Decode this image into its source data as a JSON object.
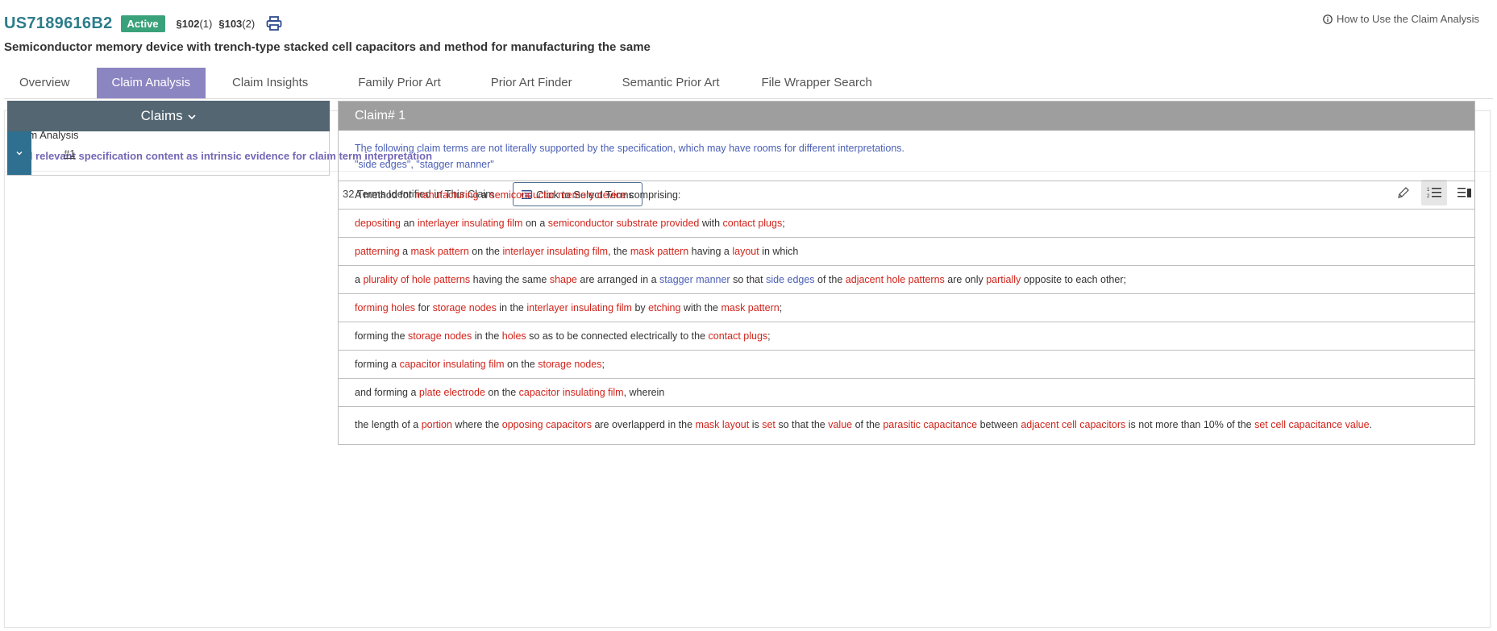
{
  "header": {
    "patent_number": "US7189616B2",
    "status_badge": "Active",
    "sections": [
      {
        "label": "§102",
        "count": "(1)"
      },
      {
        "label": "§103",
        "count": "(2)"
      }
    ],
    "print_icon": "print-icon",
    "howto_label": "How to Use the Claim Analysis",
    "howto_icon": "info-icon",
    "title": "Semiconductor memory device with trench-type stacked cell capacitors and method for manufacturing the same"
  },
  "tabs": [
    {
      "label": "Overview",
      "active": false
    },
    {
      "label": "Claim Analysis",
      "active": true
    },
    {
      "label": "Claim Insights",
      "active": false
    },
    {
      "label": "Family Prior Art",
      "active": false
    },
    {
      "label": "Prior Art Finder",
      "active": false
    },
    {
      "label": "Semantic Prior Art",
      "active": false
    },
    {
      "label": "File Wrapper Search",
      "active": false
    }
  ],
  "panel": {
    "title": "Claim Analysis",
    "subtitle": "Find relevant specification content as intrinsic evidence for claim term interpretation",
    "terms_count": "32 Terms Identified in This Claim",
    "select_button": "Click to Select Terms",
    "view_icons": [
      "pencil-icon",
      "numbered-list-icon",
      "list-detail-icon"
    ]
  },
  "sidebar": {
    "header": "Claims",
    "header_icon": "chevron-down-icon",
    "items": [
      {
        "label": "#1",
        "toggle_icon": "chevron-down-icon"
      }
    ]
  },
  "claim": {
    "header": "Claim# 1",
    "notice_line1": "The following claim terms are not literally supported by the specification, which may have rooms for different interpretations.",
    "notice_line2": "\"side edges\", \"stagger manner\"",
    "colors": {
      "term": "#d0241b",
      "unsupported_term": "#4a5fb5",
      "accent": "#8b85c1",
      "patent_number": "#2d7d8a",
      "active_badge": "#3aa27a"
    },
    "lines": [
      [
        {
          "t": "A method for "
        },
        {
          "t": "manufacturing",
          "k": "term"
        },
        {
          "t": " a "
        },
        {
          "t": "semiconductor memory device",
          "k": "term"
        },
        {
          "t": " comprising:"
        }
      ],
      [
        {
          "t": "depositing",
          "k": "term"
        },
        {
          "t": " an "
        },
        {
          "t": "interlayer insulating film",
          "k": "term"
        },
        {
          "t": " on a "
        },
        {
          "t": "semiconductor substrate provided",
          "k": "term"
        },
        {
          "t": " with "
        },
        {
          "t": "contact plugs",
          "k": "term"
        },
        {
          "t": ";"
        }
      ],
      [
        {
          "t": "patterning",
          "k": "term"
        },
        {
          "t": " a "
        },
        {
          "t": "mask pattern",
          "k": "term"
        },
        {
          "t": " on the "
        },
        {
          "t": "interlayer insulating film",
          "k": "term"
        },
        {
          "t": ", the "
        },
        {
          "t": "mask pattern",
          "k": "term"
        },
        {
          "t": " having a "
        },
        {
          "t": "layout",
          "k": "term"
        },
        {
          "t": " in which"
        }
      ],
      [
        {
          "t": "a "
        },
        {
          "t": "plurality of hole patterns",
          "k": "term"
        },
        {
          "t": " having the same "
        },
        {
          "t": "shape",
          "k": "term"
        },
        {
          "t": " are arranged in a "
        },
        {
          "t": "stagger manner",
          "k": "unsupported"
        },
        {
          "t": " so that "
        },
        {
          "t": "side edges",
          "k": "unsupported"
        },
        {
          "t": " of the "
        },
        {
          "t": "adjacent hole patterns",
          "k": "term"
        },
        {
          "t": " are only "
        },
        {
          "t": "partially",
          "k": "term"
        },
        {
          "t": " opposite to each other;"
        }
      ],
      [
        {
          "t": "forming holes",
          "k": "term"
        },
        {
          "t": " for "
        },
        {
          "t": "storage nodes",
          "k": "term"
        },
        {
          "t": " in the "
        },
        {
          "t": "interlayer insulating film",
          "k": "term"
        },
        {
          "t": " by "
        },
        {
          "t": "etching",
          "k": "term"
        },
        {
          "t": " with the "
        },
        {
          "t": "mask pattern",
          "k": "term"
        },
        {
          "t": ";"
        }
      ],
      [
        {
          "t": "forming the "
        },
        {
          "t": "storage nodes",
          "k": "term"
        },
        {
          "t": " in the "
        },
        {
          "t": "holes",
          "k": "term"
        },
        {
          "t": " so as to be connected electrically to the "
        },
        {
          "t": "contact plugs",
          "k": "term"
        },
        {
          "t": ";"
        }
      ],
      [
        {
          "t": "forming a "
        },
        {
          "t": "capacitor insulating film",
          "k": "term"
        },
        {
          "t": " on the "
        },
        {
          "t": "storage nodes",
          "k": "term"
        },
        {
          "t": ";"
        }
      ],
      [
        {
          "t": "and forming a "
        },
        {
          "t": "plate electrode",
          "k": "term"
        },
        {
          "t": " on the "
        },
        {
          "t": "capacitor insulating film",
          "k": "term"
        },
        {
          "t": ", wherein"
        }
      ],
      [
        {
          "t": "the length of a "
        },
        {
          "t": "portion",
          "k": "term"
        },
        {
          "t": " where the "
        },
        {
          "t": "opposing capacitors",
          "k": "term"
        },
        {
          "t": " are overlapperd in the "
        },
        {
          "t": "mask layout",
          "k": "term"
        },
        {
          "t": " is "
        },
        {
          "t": "set",
          "k": "term"
        },
        {
          "t": " so that the "
        },
        {
          "t": "value",
          "k": "term"
        },
        {
          "t": " of the "
        },
        {
          "t": "parasitic capacitance",
          "k": "term"
        },
        {
          "t": " between "
        },
        {
          "t": "adjacent cell capacitors",
          "k": "term"
        },
        {
          "t": " is not more than 10% of the "
        },
        {
          "t": "set cell capacitance value",
          "k": "term"
        },
        {
          "t": "."
        }
      ]
    ]
  }
}
